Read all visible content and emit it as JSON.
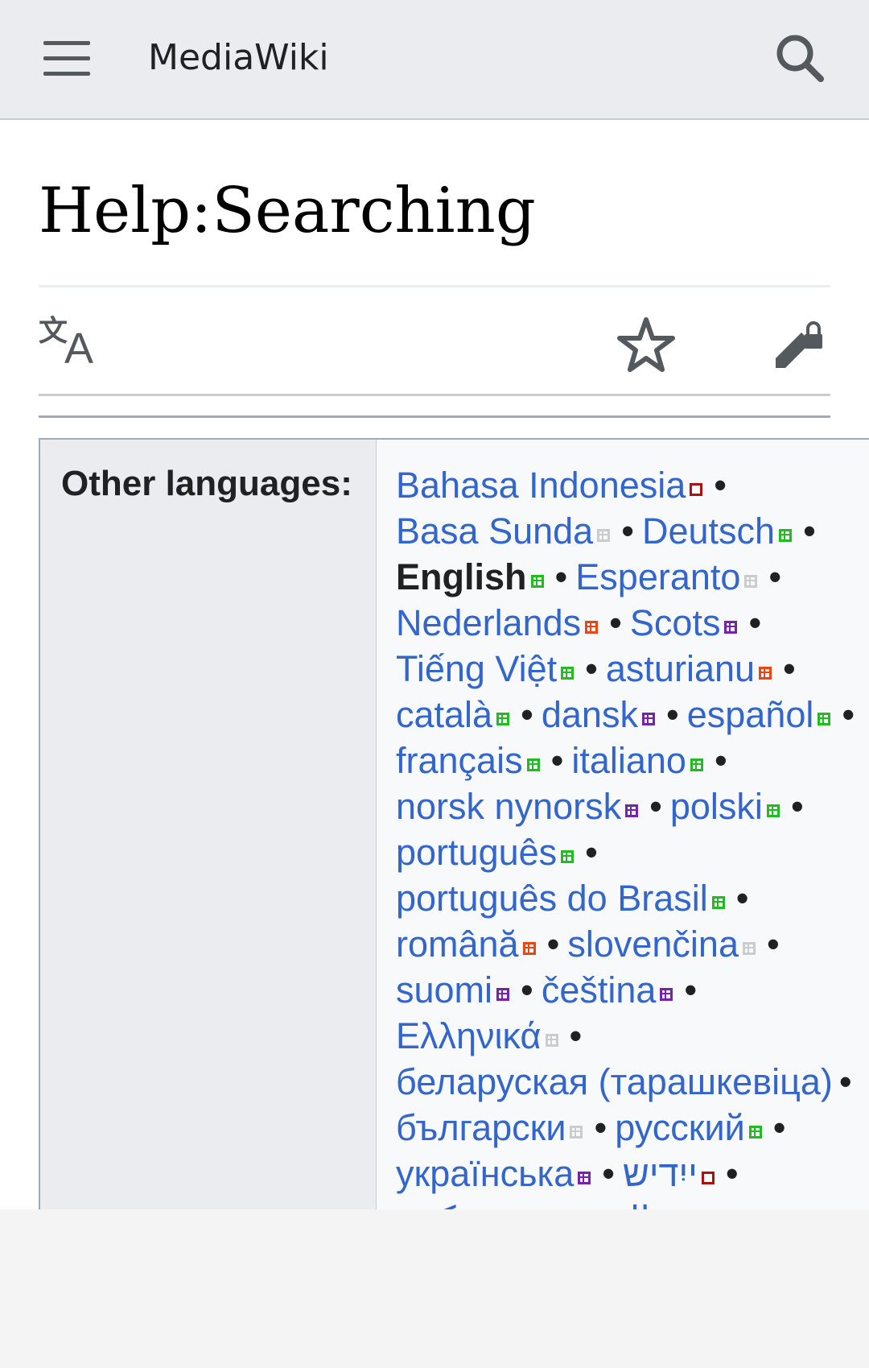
{
  "header": {
    "site_title": "MediaWiki",
    "menu_icon": "hamburger-menu-icon",
    "search_icon": "search-icon"
  },
  "page": {
    "title": "Help:Searching"
  },
  "actions": {
    "language_icon": "translate-icon",
    "watch_icon": "star-icon",
    "edit_icon": "edit-lock-icon"
  },
  "languages": {
    "label": "Other languages:",
    "lines": [
      [
        {
          "name": "Bahasa Indonesia",
          "status": "dark"
        }
      ],
      [
        {
          "name": "Basa Sunda",
          "status": "grey"
        },
        {
          "name": "Deutsch",
          "status": "green"
        }
      ],
      [
        {
          "name": "English",
          "status": "green",
          "current": true
        },
        {
          "name": "Esperanto",
          "status": "grey"
        }
      ],
      [
        {
          "name": "Nederlands",
          "status": "red"
        },
        {
          "name": "Scots",
          "status": "purple"
        }
      ],
      [
        {
          "name": "Tiếng Việt",
          "status": "green"
        },
        {
          "name": "asturianu",
          "status": "red"
        }
      ],
      [
        {
          "name": "català",
          "status": "green"
        },
        {
          "name": "dansk",
          "status": "purple"
        },
        {
          "name": "español",
          "status": "green"
        }
      ],
      [
        {
          "name": "français",
          "status": "green"
        },
        {
          "name": "italiano",
          "status": "green"
        }
      ],
      [
        {
          "name": "norsk nynorsk",
          "status": "purple"
        },
        {
          "name": "polski",
          "status": "green"
        }
      ],
      [
        {
          "name": "português",
          "status": "green"
        }
      ],
      [
        {
          "name": "português do Brasil",
          "status": "green"
        }
      ],
      [
        {
          "name": "română",
          "status": "red"
        },
        {
          "name": "slovenčina",
          "status": "grey"
        }
      ],
      [
        {
          "name": "suomi",
          "status": "purple"
        },
        {
          "name": "čeština",
          "status": "purple"
        }
      ],
      [
        {
          "name": "Ελληνικά",
          "status": "grey"
        }
      ],
      [
        {
          "name": "беларуская (тарашкевіца)",
          "status": "none"
        }
      ],
      [
        {
          "name": "български",
          "status": "grey"
        },
        {
          "name": "русский",
          "status": "green"
        }
      ],
      [
        {
          "name": "українська",
          "status": "purple"
        },
        {
          "name": "ייִדיש",
          "status": "dark"
        }
      ],
      [
        {
          "name": "עברית",
          "status": "grey"
        },
        {
          "name": "العربية",
          "status": "grey"
        },
        {
          "name": "تۆرکجه",
          "status": "grey"
        }
      ]
    ]
  },
  "colors": {
    "link": "#3366cc",
    "header_bg": "#eaecf0",
    "complete": "#22bb22",
    "partial": "#ee4411",
    "incomplete": "#7722aa",
    "outdated": "#cccccc"
  }
}
